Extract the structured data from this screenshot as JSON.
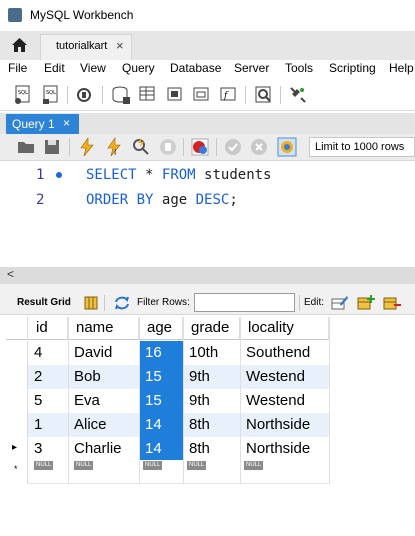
{
  "window": {
    "title": "MySQL Workbench"
  },
  "connection_tab": {
    "label": "tutorialkart",
    "close": "×"
  },
  "menu": [
    "File",
    "Edit",
    "View",
    "Query",
    "Database",
    "Server",
    "Tools",
    "Scripting",
    "Help"
  ],
  "query_tab": {
    "label": "Query 1",
    "close": "×"
  },
  "editor": {
    "limit_label": "Limit to 1000 rows",
    "lines": [
      {
        "num": "1",
        "code": "SELECT * FROM students"
      },
      {
        "num": "2",
        "code": "ORDER BY age DESC;"
      }
    ]
  },
  "result_toolbar": {
    "result_grid_label": "Result Grid",
    "filter_label": "Filter Rows:",
    "filter_value": "",
    "edit_label": "Edit:"
  },
  "grid": {
    "columns": [
      "id",
      "name",
      "age",
      "grade",
      "locality"
    ],
    "rows": [
      [
        "4",
        "David",
        "16",
        "10th",
        "Southend"
      ],
      [
        "2",
        "Bob",
        "15",
        "9th",
        "Westend"
      ],
      [
        "5",
        "Eva",
        "15",
        "9th",
        "Westend"
      ],
      [
        "1",
        "Alice",
        "14",
        "8th",
        "Northside"
      ],
      [
        "3",
        "Charlie",
        "14",
        "8th",
        "Northside"
      ]
    ],
    "null_label": "NULL",
    "row_marker": "▸",
    "new_row_marker": "*"
  },
  "colors": {
    "selection": "#1f7ed9",
    "tab_active": "#2d83d6",
    "keyword": "#1860d8"
  }
}
